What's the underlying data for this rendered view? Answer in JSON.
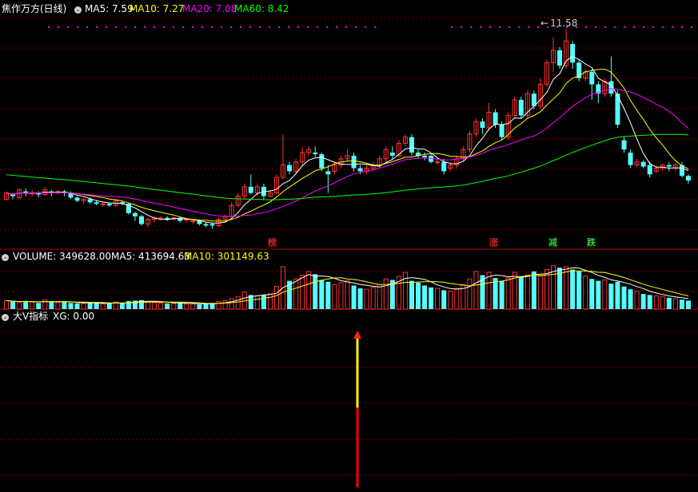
{
  "main_panel": {
    "title": "焦作万方(日线)",
    "ma5_label": "MA5: 7.59",
    "ma10_label": "MA10: 7.27",
    "ma20_label": "MA20: 7.08",
    "ma60_label": "MA60: 8.42",
    "high_label": "11.58",
    "markers": [
      "榜",
      "涨",
      "减",
      "跌"
    ]
  },
  "volume_panel": {
    "volume_label": "VOLUME: 349628.00",
    "ma5_label": "MA5: 413694.63",
    "ma10_label": "MA10: 301149.63"
  },
  "indicator_panel": {
    "name": "大V指标",
    "xg_label": "XG: 0.00"
  },
  "colors": {
    "up": "#ff3232",
    "down": "#54ffff",
    "ma5": "#ffffff",
    "ma10": "#ffff00",
    "ma20": "#ff00ff",
    "ma60": "#00ff00",
    "grid": "#7a0000",
    "vol_ma5": "#ffffff",
    "vol_ma10": "#ffff00"
  },
  "candles": [
    [
      6.1,
      6.3,
      6.05,
      6.35
    ],
    [
      6.25,
      6.2,
      6.1,
      6.3
    ],
    [
      6.15,
      6.4,
      6.1,
      6.45
    ],
    [
      6.35,
      6.3,
      6.2,
      6.45
    ],
    [
      6.3,
      6.3,
      6.2,
      6.4
    ],
    [
      6.3,
      6.25,
      6.15,
      6.35
    ],
    [
      6.25,
      6.4,
      6.2,
      6.5
    ],
    [
      6.35,
      6.3,
      6.2,
      6.4
    ],
    [
      6.3,
      6.35,
      6.25,
      6.4
    ],
    [
      6.35,
      6.3,
      6.2,
      6.4
    ],
    [
      6.3,
      6.15,
      6.1,
      6.35
    ],
    [
      6.15,
      6.05,
      6.0,
      6.2
    ],
    [
      6.05,
      6.1,
      5.95,
      6.15
    ],
    [
      6.1,
      6.0,
      5.95,
      6.15
    ],
    [
      6.0,
      5.95,
      5.9,
      6.05
    ],
    [
      5.95,
      5.95,
      5.85,
      6.0
    ],
    [
      5.95,
      5.9,
      5.85,
      6.0
    ],
    [
      5.9,
      6.05,
      5.85,
      6.1
    ],
    [
      6.0,
      5.95,
      5.9,
      6.05
    ],
    [
      5.95,
      5.65,
      5.6,
      6.0
    ],
    [
      5.65,
      5.55,
      5.4,
      5.7
    ],
    [
      5.55,
      5.3,
      5.25,
      5.6
    ],
    [
      5.3,
      5.45,
      5.2,
      5.5
    ],
    [
      5.45,
      5.5,
      5.35,
      5.55
    ],
    [
      5.45,
      5.5,
      5.4,
      5.55
    ],
    [
      5.5,
      5.45,
      5.4,
      5.55
    ],
    [
      5.45,
      5.5,
      5.4,
      5.55
    ],
    [
      5.5,
      5.4,
      5.35,
      5.55
    ],
    [
      5.45,
      5.45,
      5.35,
      5.5
    ],
    [
      5.4,
      5.4,
      5.3,
      5.45
    ],
    [
      5.4,
      5.3,
      5.25,
      5.45
    ],
    [
      5.3,
      5.25,
      5.2,
      5.35
    ],
    [
      5.3,
      5.25,
      5.15,
      5.35
    ],
    [
      5.25,
      5.45,
      5.2,
      5.5
    ],
    [
      5.45,
      5.55,
      5.35,
      5.6
    ],
    [
      5.55,
      5.9,
      5.5,
      6.0
    ],
    [
      5.9,
      6.2,
      5.85,
      6.3
    ],
    [
      6.2,
      6.5,
      6.1,
      6.6
    ],
    [
      6.5,
      6.3,
      6.25,
      6.9
    ],
    [
      6.3,
      6.5,
      6.2,
      6.6
    ],
    [
      6.5,
      6.2,
      6.1,
      6.6
    ],
    [
      6.2,
      6.3,
      6.15,
      6.4
    ],
    [
      6.3,
      6.8,
      6.25,
      6.9
    ],
    [
      6.8,
      7.2,
      6.75,
      8.2
    ],
    [
      7.2,
      7.0,
      6.9,
      7.3
    ],
    [
      7.0,
      7.3,
      6.95,
      7.4
    ],
    [
      7.3,
      7.6,
      7.2,
      7.8
    ],
    [
      7.6,
      7.7,
      7.5,
      7.8
    ],
    [
      7.6,
      7.55,
      7.45,
      7.8
    ],
    [
      7.55,
      7.1,
      7.0,
      7.6
    ],
    [
      7.0,
      6.9,
      6.3,
      7.2
    ],
    [
      7.0,
      7.2,
      6.9,
      7.3
    ],
    [
      7.2,
      7.4,
      7.1,
      7.5
    ],
    [
      7.4,
      7.5,
      7.3,
      7.7
    ],
    [
      7.5,
      7.1,
      7.0,
      7.6
    ],
    [
      7.1,
      7.0,
      6.9,
      7.2
    ],
    [
      7.0,
      7.1,
      6.9,
      7.2
    ],
    [
      7.1,
      7.2,
      7.0,
      7.3
    ],
    [
      7.2,
      7.4,
      7.1,
      7.5
    ],
    [
      7.4,
      7.7,
      7.3,
      7.8
    ],
    [
      7.6,
      7.5,
      7.4,
      7.8
    ],
    [
      7.5,
      7.9,
      7.45,
      8.0
    ],
    [
      7.9,
      8.1,
      7.8,
      8.2
    ],
    [
      8.1,
      7.6,
      7.5,
      8.2
    ],
    [
      7.6,
      7.5,
      7.4,
      7.7
    ],
    [
      7.5,
      7.45,
      7.35,
      7.6
    ],
    [
      7.5,
      7.3,
      7.25,
      7.6
    ],
    [
      7.3,
      7.3,
      7.2,
      7.45
    ],
    [
      7.3,
      7.0,
      6.9,
      7.4
    ],
    [
      7.1,
      7.2,
      7.0,
      7.3
    ],
    [
      7.2,
      7.4,
      7.1,
      7.5
    ],
    [
      7.4,
      7.7,
      7.3,
      7.8
    ],
    [
      7.7,
      8.2,
      7.6,
      8.3
    ],
    [
      8.2,
      8.6,
      8.1,
      8.7
    ],
    [
      8.6,
      8.4,
      8.2,
      8.7
    ],
    [
      8.4,
      8.9,
      8.3,
      9.2
    ],
    [
      8.9,
      8.5,
      8.4,
      9.0
    ],
    [
      8.5,
      8.1,
      8.0,
      8.6
    ],
    [
      8.1,
      8.8,
      8.0,
      8.9
    ],
    [
      8.8,
      9.3,
      8.7,
      9.4
    ],
    [
      9.3,
      8.8,
      8.7,
      9.4
    ],
    [
      8.8,
      9.5,
      8.7,
      9.6
    ],
    [
      9.5,
      9.1,
      9.0,
      9.6
    ],
    [
      9.1,
      9.8,
      9.0,
      10.0
    ],
    [
      9.8,
      10.5,
      9.7,
      10.6
    ],
    [
      10.5,
      10.9,
      10.2,
      11.3
    ],
    [
      10.9,
      10.4,
      10.3,
      11.0
    ],
    [
      10.4,
      11.2,
      10.3,
      11.58
    ],
    [
      11.1,
      10.5,
      10.3,
      11.2
    ],
    [
      10.5,
      10.0,
      9.9,
      10.6
    ],
    [
      10.0,
      10.2,
      9.9,
      10.3
    ],
    [
      10.2,
      9.8,
      9.3,
      10.3
    ],
    [
      9.8,
      9.5,
      9.2,
      9.9
    ],
    [
      9.5,
      9.9,
      9.4,
      10.0
    ],
    [
      9.9,
      9.5,
      9.4,
      10.7
    ],
    [
      9.5,
      8.5,
      8.4,
      9.6
    ],
    [
      8.0,
      7.7,
      7.6,
      8.1
    ],
    [
      7.6,
      7.2,
      7.1,
      7.7
    ],
    [
      7.2,
      7.3,
      7.15,
      7.4
    ],
    [
      7.3,
      7.15,
      7.1,
      7.35
    ],
    [
      7.2,
      6.9,
      6.8,
      7.3
    ],
    [
      7.0,
      7.1,
      6.95,
      7.2
    ],
    [
      7.1,
      7.2,
      7.0,
      7.25
    ],
    [
      7.2,
      7.15,
      7.0,
      7.3
    ],
    [
      7.1,
      7.2,
      7.0,
      7.25
    ],
    [
      7.2,
      6.85,
      6.8,
      7.3
    ],
    [
      6.85,
      6.7,
      6.6,
      6.9
    ]
  ],
  "volume_scale_max": 100,
  "volumes": [
    18,
    16,
    14,
    17,
    15,
    13,
    20,
    15,
    14,
    16,
    13,
    12,
    12,
    14,
    13,
    11,
    12,
    15,
    12,
    17,
    18,
    19,
    16,
    14,
    13,
    12,
    12,
    14,
    11,
    11,
    10,
    11,
    12,
    16,
    18,
    22,
    26,
    36,
    30,
    28,
    30,
    32,
    48,
    90,
    60,
    64,
    72,
    80,
    74,
    62,
    58,
    52,
    56,
    60,
    50,
    44,
    42,
    46,
    52,
    64,
    62,
    70,
    78,
    60,
    56,
    50,
    46,
    44,
    40,
    38,
    44,
    52,
    64,
    80,
    72,
    78,
    66,
    60,
    66,
    78,
    70,
    72,
    80,
    70,
    84,
    92,
    88,
    90,
    84,
    80,
    70,
    64,
    60,
    62,
    54,
    58,
    48,
    42,
    38,
    32,
    30,
    28,
    26,
    24,
    22,
    20,
    18
  ],
  "indicator_spike_value": 1
}
